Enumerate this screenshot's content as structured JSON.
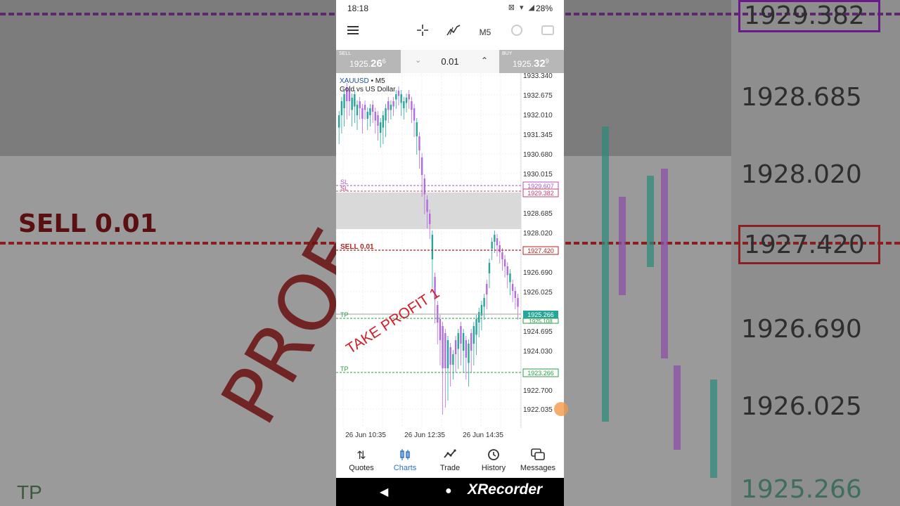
{
  "status": {
    "time": "18:18",
    "battery": "28%"
  },
  "toolbar": {
    "timeframe": "M5"
  },
  "trade": {
    "sell_label": "SELL",
    "sell_price_main": "1925.",
    "sell_price_big": "26",
    "sell_price_sup": "6",
    "buy_label": "BUY",
    "buy_price_main": "1925.",
    "buy_price_big": "32",
    "buy_price_sup": "9",
    "lot": "0.01"
  },
  "chart": {
    "symbol": "XAUUSD",
    "timeframe_suffix": " • M5",
    "description": "Gold vs US Dollar",
    "price_labels": [
      "1933.340",
      "1932.675",
      "1932.010",
      "1931.345",
      "1930.680",
      "1930.015",
      "1928.685",
      "1928.020",
      "1926.690",
      "1926.025",
      "1924.695",
      "1924.030",
      "1922.700",
      "1922.035"
    ],
    "time_labels": [
      "26 Jun 10:35",
      "26 Jun 12:35",
      "26 Jun 14:35"
    ],
    "sl_label": "SL",
    "sl2_label": "SL",
    "sl_price": "1929.607",
    "sl2_price": "1929.382",
    "order_label": "SELL 0.01",
    "order_price": "1927.420",
    "tp_label": "TP",
    "tp1_price": "1925.108",
    "tp2_label": "TP",
    "tp2_price": "1923.266",
    "current_price": "1925.266",
    "annotation": "TAKE PROFIT 1",
    "colors": {
      "bull": "#26a69a",
      "bear": "#b36be0",
      "sl": "#a855c8",
      "order": "#b22222",
      "tp": "#2e9e4a",
      "current": "#26a69a"
    }
  },
  "nav": {
    "quotes": "Quotes",
    "charts": "Charts",
    "trade": "Trade",
    "history": "History",
    "messages": "Messages"
  },
  "background": {
    "prices": [
      "1929.382",
      "1928.685",
      "1928.020",
      "1927.420",
      "1926.690",
      "1926.025",
      "1925.266"
    ],
    "sell_label": "SELL 0.01",
    "profit_text": "PROF",
    "tp_label": "TP"
  },
  "watermark": "XRecorder"
}
